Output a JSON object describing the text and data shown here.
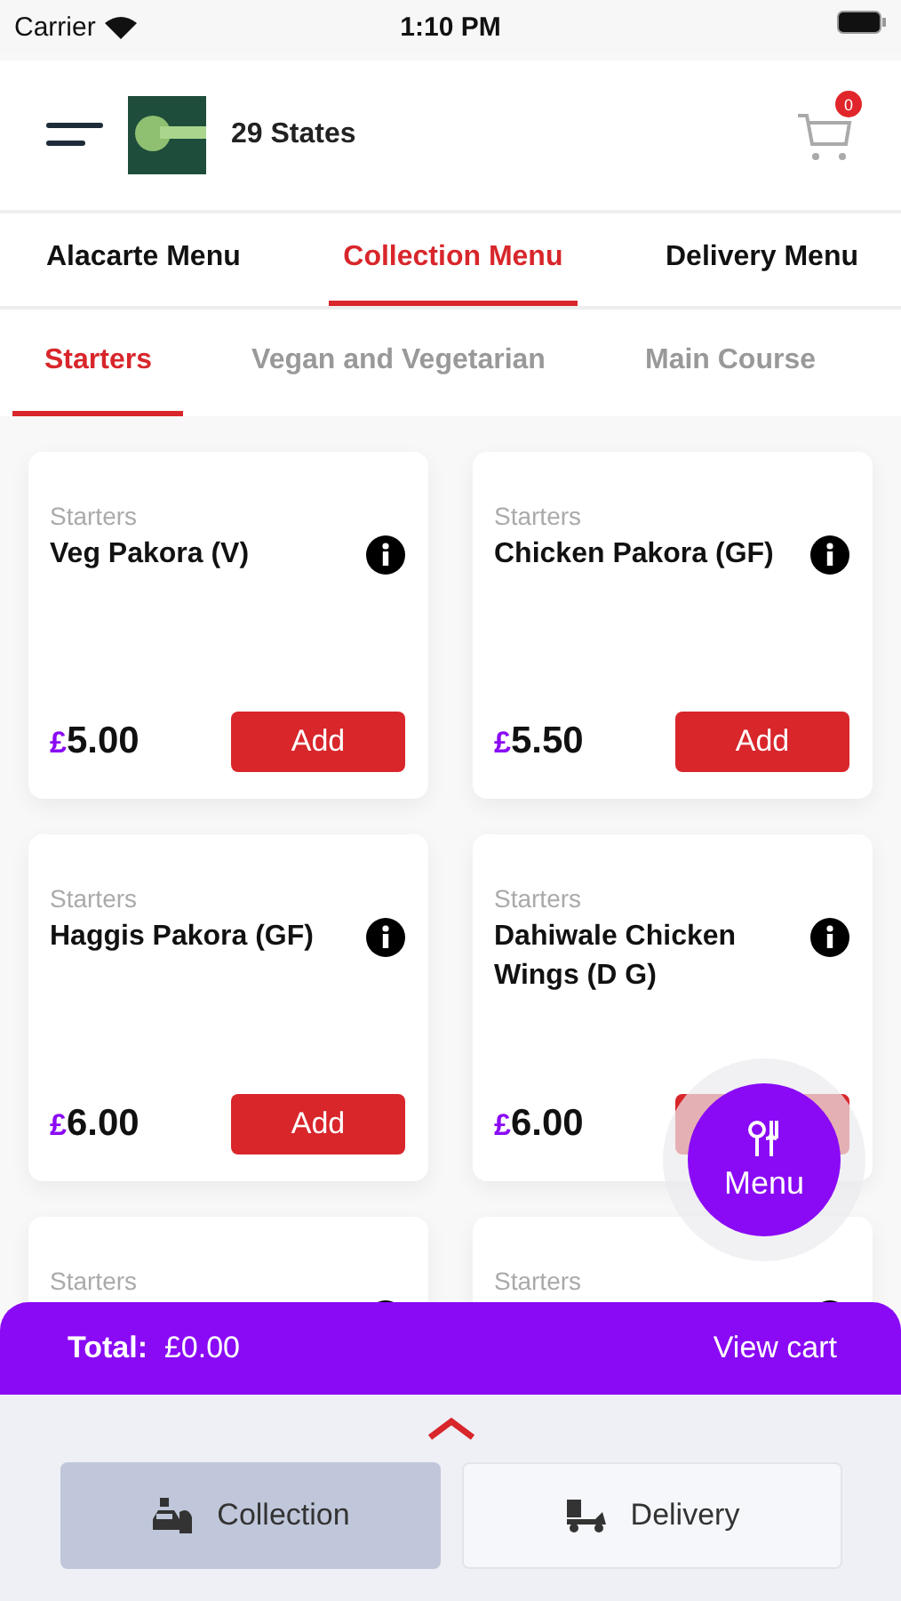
{
  "status_bar": {
    "carrier": "Carrier",
    "time": "1:10 PM"
  },
  "header": {
    "title": "29 States",
    "cart_count": "0"
  },
  "menu_tabs": [
    {
      "label": "Alacarte Menu",
      "selected": false
    },
    {
      "label": "Collection Menu",
      "selected": true
    },
    {
      "label": "Delivery Menu",
      "selected": false
    }
  ],
  "category_tabs": [
    {
      "label": "Starters",
      "selected": true
    },
    {
      "label": "Vegan and Vegetarian",
      "selected": false
    },
    {
      "label": "Main Course",
      "selected": false
    }
  ],
  "items": [
    {
      "category": "Starters",
      "name": "Veg Pakora (V)",
      "currency": "£",
      "price": "5.00",
      "button": "Add"
    },
    {
      "category": "Starters",
      "name": "Chicken Pakora (GF)",
      "currency": "£",
      "price": "5.50",
      "button": "Add"
    },
    {
      "category": "Starters",
      "name": "Haggis Pakora (GF)",
      "currency": "£",
      "price": "6.00",
      "button": "Add"
    },
    {
      "category": "Starters",
      "name": "Dahiwale Chicken Wings (D G)",
      "currency": "£",
      "price": "6.00"
    },
    {
      "category": "Starters"
    },
    {
      "category": "Starters"
    }
  ],
  "menu_button": {
    "label": "Menu"
  },
  "cart_bar": {
    "total_label": "Total:",
    "total": "£0.00",
    "view_cart": "View cart"
  },
  "order_types": [
    {
      "label": "Collection",
      "kind": "collection",
      "selected": true
    },
    {
      "label": "Delivery",
      "kind": "delivery",
      "selected": false
    }
  ]
}
